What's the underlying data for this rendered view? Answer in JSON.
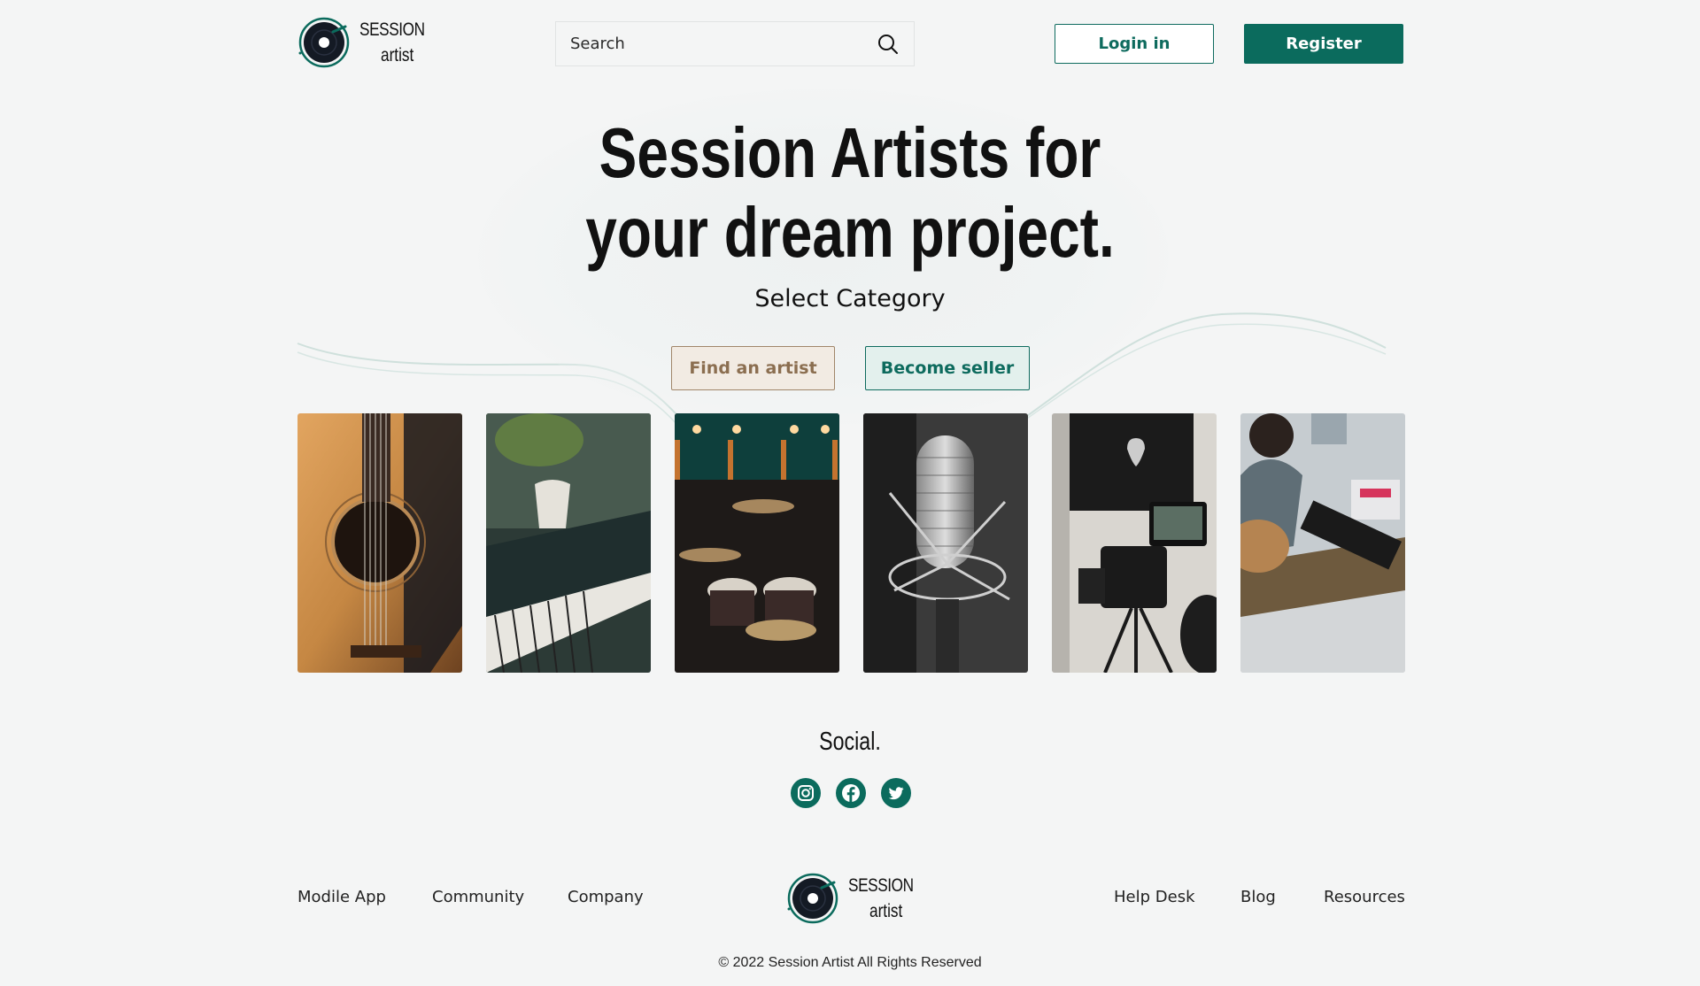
{
  "header": {
    "logo": {
      "line1": "SESSION",
      "line2": "artist"
    },
    "search": {
      "placeholder": "Search"
    },
    "login_label": "Login in",
    "register_label": "Register"
  },
  "hero": {
    "title_line1": "Session Artists for",
    "title_line2": "your dream project.",
    "subtitle": "Select Category",
    "find_artist_label": "Find an artist",
    "become_seller_label": "Become seller"
  },
  "categories": [
    {
      "icon": "acoustic-guitar-photo"
    },
    {
      "icon": "piano-photo"
    },
    {
      "icon": "drum-kit-photo"
    },
    {
      "icon": "studio-microphone-photo"
    },
    {
      "icon": "video-camera-photo"
    },
    {
      "icon": "guitarist-keyboard-photo"
    }
  ],
  "social": {
    "title": "Social.",
    "icons": [
      "instagram-icon",
      "facebook-icon",
      "twitter-icon"
    ]
  },
  "footer": {
    "left_links": [
      "Modile App",
      "Community",
      "Company"
    ],
    "right_links": [
      "Help Desk",
      "Blog",
      "Resources"
    ],
    "logo": {
      "line1": "SESSION",
      "line2": "artist"
    },
    "copyright": "© 2022 Session Artist All Rights Reserved"
  },
  "colors": {
    "brand": "#0b6b5d",
    "accent_tan": "#a1866a",
    "background": "#f4f5f5"
  }
}
